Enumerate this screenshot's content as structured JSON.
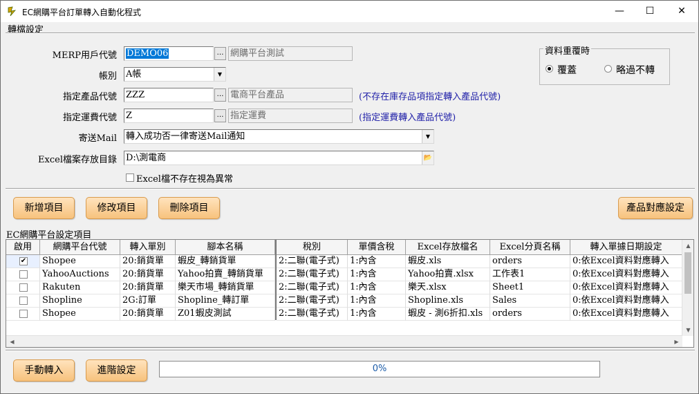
{
  "window": {
    "title": "EC網購平台訂單轉入自動化程式",
    "minimize": "—",
    "maximize": "☐",
    "close": "✕"
  },
  "settings": {
    "section_title": "轉檔設定",
    "merp_label": "MERP用戶代號",
    "merp_value": "DEMO06",
    "merp_desc": "網購平台測試",
    "account_label": "帳別",
    "account_value": "A帳",
    "product_label": "指定產品代號",
    "product_value": "ZZZ",
    "product_desc": "電商平台產品",
    "product_note": "(不存在庫存品項指定轉入產品代號)",
    "freight_label": "指定運費代號",
    "freight_value": "Z",
    "freight_desc": "指定運費",
    "freight_note": "(指定運費轉入產品代號)",
    "mail_label": "寄送Mail",
    "mail_value": "轉入成功否一律寄送Mail通知",
    "excel_dir_label": "Excel檔案存放目錄",
    "excel_dir_value": "D:\\測電商",
    "excel_missing_label": "Excel檔不存在視為異常",
    "excel_missing_checked": false,
    "ellipsis": "…",
    "dropdown_icon": "▼",
    "folder_icon": "📂"
  },
  "duplicate": {
    "title": "資料重覆時",
    "overwrite": "覆蓋",
    "skip": "略過不轉",
    "selected": "覆蓋"
  },
  "buttons": {
    "add": "新增項目",
    "edit": "修改項目",
    "delete": "刪除項目",
    "product_map": "產品對應設定",
    "manual_import": "手動轉入",
    "advanced": "進階設定"
  },
  "platform_grid": {
    "section_title": "EC網購平台設定項目",
    "columns": [
      "啟用",
      "網購平台代號",
      "轉入單別",
      "腳本名稱",
      "稅別",
      "單價含稅",
      "Excel存放檔名",
      "Excel分頁名稱",
      "轉入單據日期設定"
    ],
    "rows": [
      {
        "enabled": true,
        "platform": "Shopee",
        "doc_type": "20:銷貨單",
        "script": "蝦皮_轉銷貨單",
        "tax": "2:二聯(電子式)",
        "price_tax": "1:內含",
        "file": "蝦皮.xls",
        "sheet": "orders",
        "date": "0:依Excel資料對應轉入"
      },
      {
        "enabled": false,
        "platform": "YahooAuctions",
        "doc_type": "20:銷貨單",
        "script": "Yahoo拍賣_轉銷貨單",
        "tax": "2:二聯(電子式)",
        "price_tax": "1:內含",
        "file": "Yahoo拍賣.xlsx",
        "sheet": "工作表1",
        "date": "0:依Excel資料對應轉入"
      },
      {
        "enabled": false,
        "platform": "Rakuten",
        "doc_type": "20:銷貨單",
        "script": "樂天市場_轉銷貨單",
        "tax": "2:二聯(電子式)",
        "price_tax": "1:內含",
        "file": "樂天.xlsx",
        "sheet": "Sheet1",
        "date": "0:依Excel資料對應轉入"
      },
      {
        "enabled": false,
        "platform": "Shopline",
        "doc_type": "2G:訂單",
        "script": "Shopline_轉訂單",
        "tax": "2:二聯(電子式)",
        "price_tax": "1:內含",
        "file": "Shopline.xls",
        "sheet": "Sales",
        "date": "0:依Excel資料對應轉入"
      },
      {
        "enabled": false,
        "platform": "Shopee",
        "doc_type": "20:銷貨單",
        "script": "Z01蝦皮測試",
        "tax": "2:二聯(電子式)",
        "price_tax": "1:內含",
        "file": "蝦皮 - 測6折扣.xls",
        "sheet": "orders",
        "date": "0:依Excel資料對應轉入"
      }
    ],
    "scroll_up": "▲",
    "scroll_down": "▼",
    "scroll_left": "◀",
    "scroll_right": "▶"
  },
  "progress": {
    "label": "0%",
    "value": 0
  }
}
